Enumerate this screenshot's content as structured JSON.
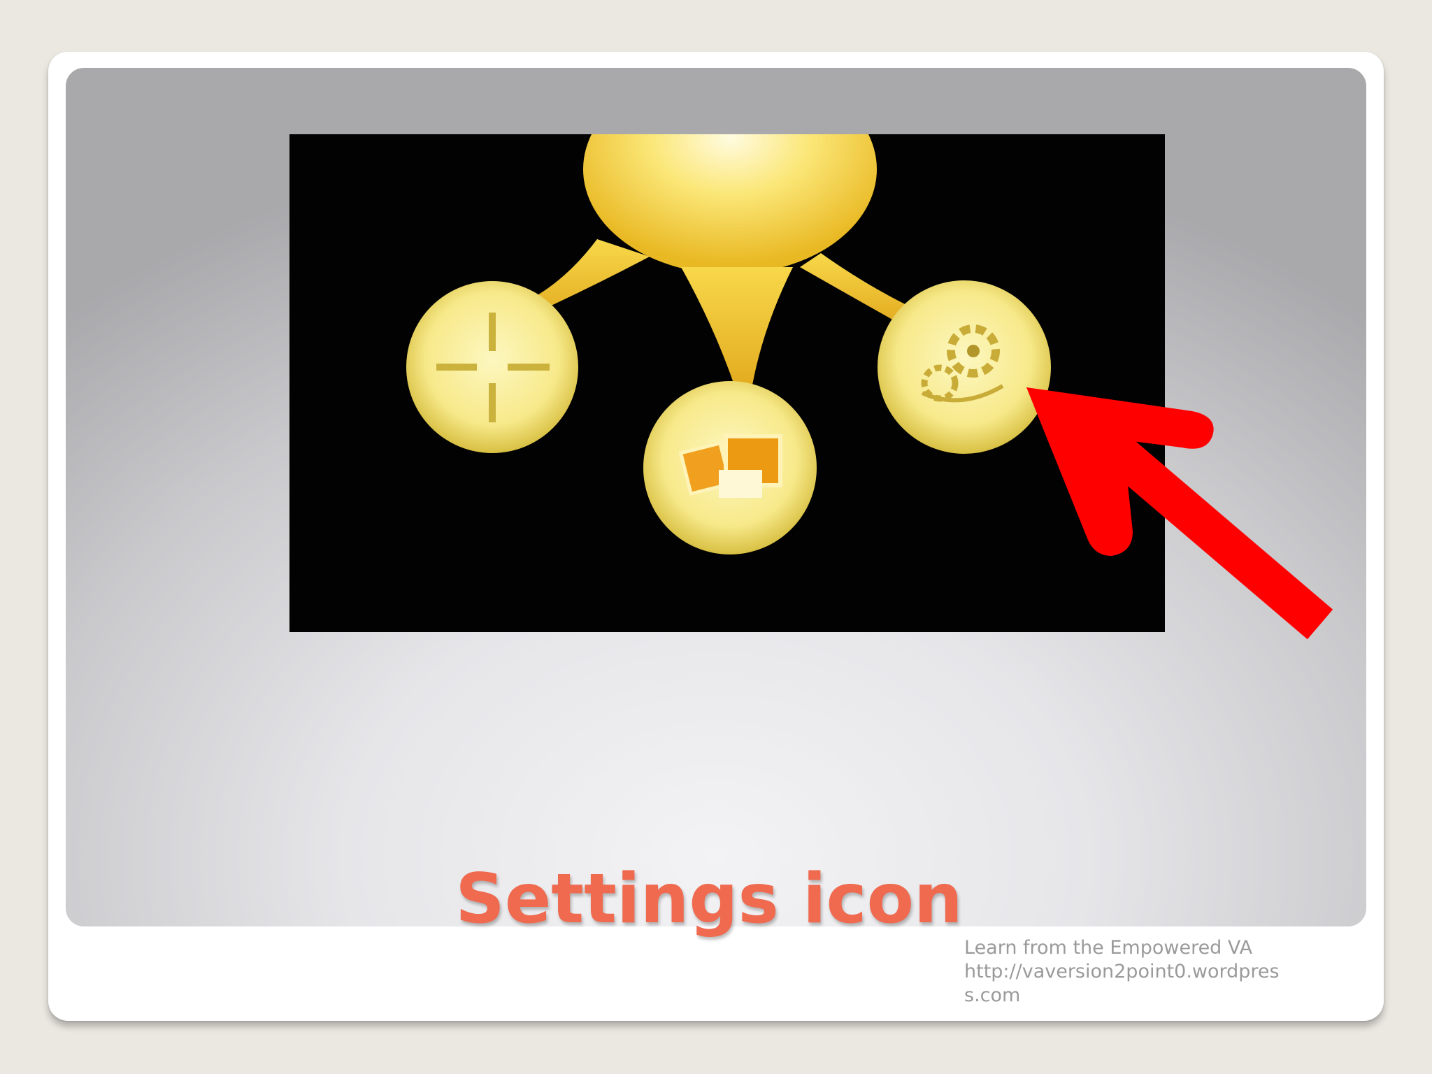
{
  "slide": {
    "title": "Settings icon",
    "credit": {
      "line1": "Learn from the Empowered VA",
      "line2": "http://vaversion2point0.wordpress.com"
    }
  },
  "photo": {
    "description_icons": [
      "crosshair-icon",
      "photos-icon",
      "gear-icon"
    ],
    "accent_color": "#f5dd55"
  },
  "arrow": {
    "color": "#ff0000"
  }
}
